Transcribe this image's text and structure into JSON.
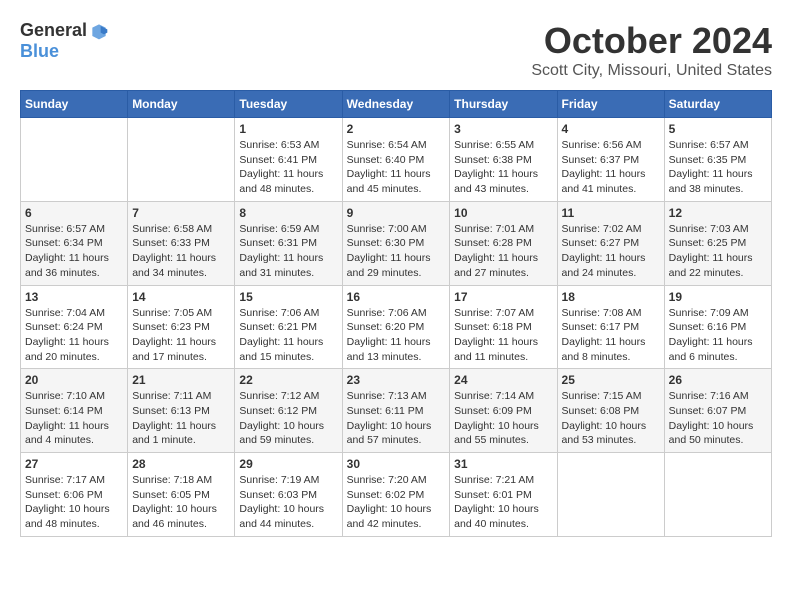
{
  "header": {
    "logo_general": "General",
    "logo_blue": "Blue",
    "month_title": "October 2024",
    "location": "Scott City, Missouri, United States"
  },
  "days_of_week": [
    "Sunday",
    "Monday",
    "Tuesday",
    "Wednesday",
    "Thursday",
    "Friday",
    "Saturday"
  ],
  "weeks": [
    [
      {
        "day": "",
        "info": ""
      },
      {
        "day": "",
        "info": ""
      },
      {
        "day": "1",
        "info": "Sunrise: 6:53 AM\nSunset: 6:41 PM\nDaylight: 11 hours and 48 minutes."
      },
      {
        "day": "2",
        "info": "Sunrise: 6:54 AM\nSunset: 6:40 PM\nDaylight: 11 hours and 45 minutes."
      },
      {
        "day": "3",
        "info": "Sunrise: 6:55 AM\nSunset: 6:38 PM\nDaylight: 11 hours and 43 minutes."
      },
      {
        "day": "4",
        "info": "Sunrise: 6:56 AM\nSunset: 6:37 PM\nDaylight: 11 hours and 41 minutes."
      },
      {
        "day": "5",
        "info": "Sunrise: 6:57 AM\nSunset: 6:35 PM\nDaylight: 11 hours and 38 minutes."
      }
    ],
    [
      {
        "day": "6",
        "info": "Sunrise: 6:57 AM\nSunset: 6:34 PM\nDaylight: 11 hours and 36 minutes."
      },
      {
        "day": "7",
        "info": "Sunrise: 6:58 AM\nSunset: 6:33 PM\nDaylight: 11 hours and 34 minutes."
      },
      {
        "day": "8",
        "info": "Sunrise: 6:59 AM\nSunset: 6:31 PM\nDaylight: 11 hours and 31 minutes."
      },
      {
        "day": "9",
        "info": "Sunrise: 7:00 AM\nSunset: 6:30 PM\nDaylight: 11 hours and 29 minutes."
      },
      {
        "day": "10",
        "info": "Sunrise: 7:01 AM\nSunset: 6:28 PM\nDaylight: 11 hours and 27 minutes."
      },
      {
        "day": "11",
        "info": "Sunrise: 7:02 AM\nSunset: 6:27 PM\nDaylight: 11 hours and 24 minutes."
      },
      {
        "day": "12",
        "info": "Sunrise: 7:03 AM\nSunset: 6:25 PM\nDaylight: 11 hours and 22 minutes."
      }
    ],
    [
      {
        "day": "13",
        "info": "Sunrise: 7:04 AM\nSunset: 6:24 PM\nDaylight: 11 hours and 20 minutes."
      },
      {
        "day": "14",
        "info": "Sunrise: 7:05 AM\nSunset: 6:23 PM\nDaylight: 11 hours and 17 minutes."
      },
      {
        "day": "15",
        "info": "Sunrise: 7:06 AM\nSunset: 6:21 PM\nDaylight: 11 hours and 15 minutes."
      },
      {
        "day": "16",
        "info": "Sunrise: 7:06 AM\nSunset: 6:20 PM\nDaylight: 11 hours and 13 minutes."
      },
      {
        "day": "17",
        "info": "Sunrise: 7:07 AM\nSunset: 6:18 PM\nDaylight: 11 hours and 11 minutes."
      },
      {
        "day": "18",
        "info": "Sunrise: 7:08 AM\nSunset: 6:17 PM\nDaylight: 11 hours and 8 minutes."
      },
      {
        "day": "19",
        "info": "Sunrise: 7:09 AM\nSunset: 6:16 PM\nDaylight: 11 hours and 6 minutes."
      }
    ],
    [
      {
        "day": "20",
        "info": "Sunrise: 7:10 AM\nSunset: 6:14 PM\nDaylight: 11 hours and 4 minutes."
      },
      {
        "day": "21",
        "info": "Sunrise: 7:11 AM\nSunset: 6:13 PM\nDaylight: 11 hours and 1 minute."
      },
      {
        "day": "22",
        "info": "Sunrise: 7:12 AM\nSunset: 6:12 PM\nDaylight: 10 hours and 59 minutes."
      },
      {
        "day": "23",
        "info": "Sunrise: 7:13 AM\nSunset: 6:11 PM\nDaylight: 10 hours and 57 minutes."
      },
      {
        "day": "24",
        "info": "Sunrise: 7:14 AM\nSunset: 6:09 PM\nDaylight: 10 hours and 55 minutes."
      },
      {
        "day": "25",
        "info": "Sunrise: 7:15 AM\nSunset: 6:08 PM\nDaylight: 10 hours and 53 minutes."
      },
      {
        "day": "26",
        "info": "Sunrise: 7:16 AM\nSunset: 6:07 PM\nDaylight: 10 hours and 50 minutes."
      }
    ],
    [
      {
        "day": "27",
        "info": "Sunrise: 7:17 AM\nSunset: 6:06 PM\nDaylight: 10 hours and 48 minutes."
      },
      {
        "day": "28",
        "info": "Sunrise: 7:18 AM\nSunset: 6:05 PM\nDaylight: 10 hours and 46 minutes."
      },
      {
        "day": "29",
        "info": "Sunrise: 7:19 AM\nSunset: 6:03 PM\nDaylight: 10 hours and 44 minutes."
      },
      {
        "day": "30",
        "info": "Sunrise: 7:20 AM\nSunset: 6:02 PM\nDaylight: 10 hours and 42 minutes."
      },
      {
        "day": "31",
        "info": "Sunrise: 7:21 AM\nSunset: 6:01 PM\nDaylight: 10 hours and 40 minutes."
      },
      {
        "day": "",
        "info": ""
      },
      {
        "day": "",
        "info": ""
      }
    ]
  ]
}
